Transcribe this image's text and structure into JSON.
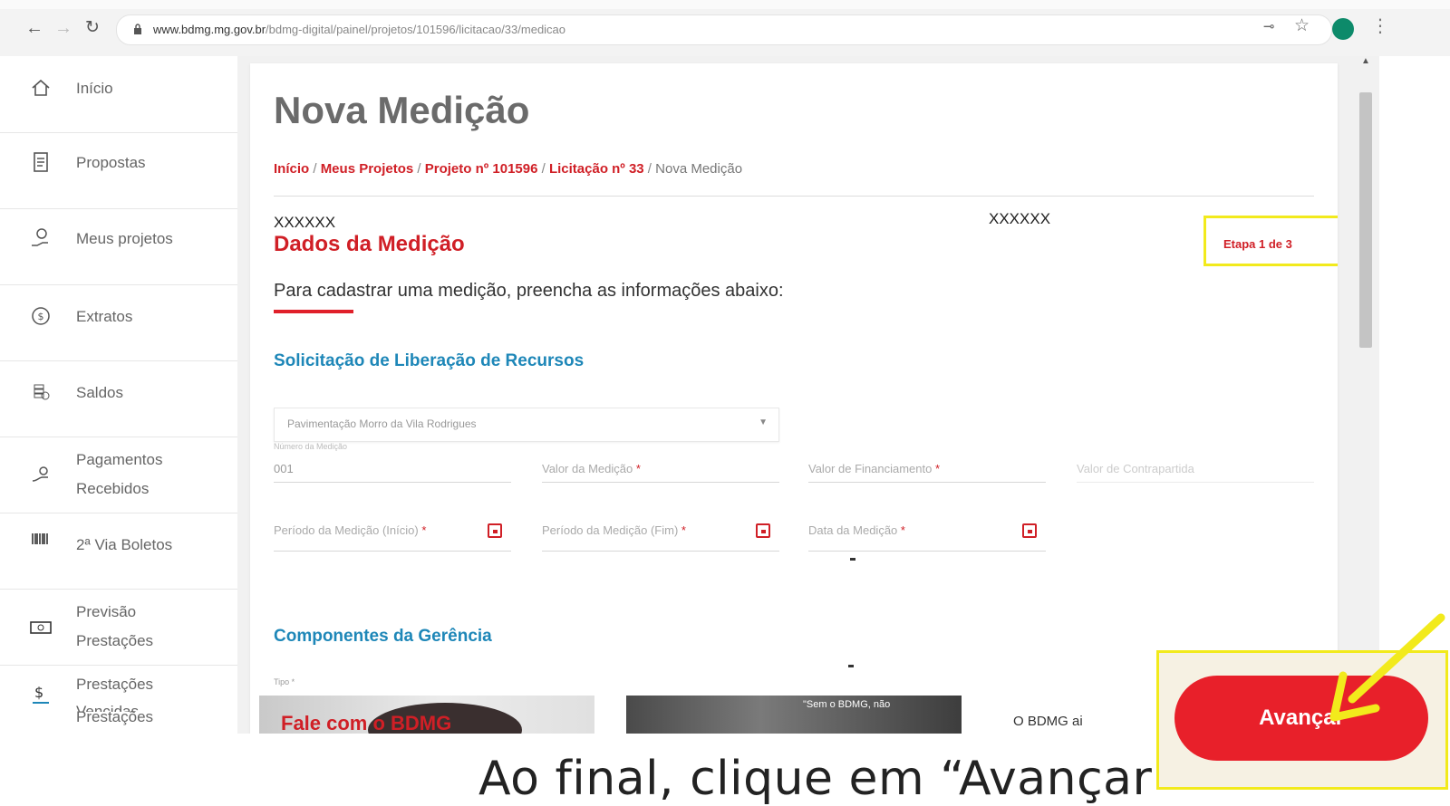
{
  "browser": {
    "url_domain": "www.bdmg.mg.gov.br",
    "url_path": "/bdmg-digital/painel/projetos/101596/licitacao/33/medicao"
  },
  "icons": {
    "back": "arrow-left-icon",
    "forward": "arrow-right-icon",
    "reload": "reload-icon",
    "lock": "lock-icon",
    "key": "key-icon",
    "star": "star-icon",
    "menu": "vertical-dots-icon"
  },
  "sidebar": {
    "items": [
      {
        "label": "Início",
        "icon": "home-icon"
      },
      {
        "label": "Propostas",
        "icon": "document-icon"
      },
      {
        "label": "Meus projetos",
        "icon": "hand-coin-icon"
      },
      {
        "label": "Extratos",
        "icon": "dollar-circle-icon"
      },
      {
        "label": "Saldos",
        "icon": "coins-icon"
      },
      {
        "label": "Pagamentos",
        "label2": "Recebidos",
        "icon": "payment-hand-icon"
      },
      {
        "label": "2ª Via Boletos",
        "icon": "barcode-icon"
      },
      {
        "label": "Previsão",
        "label2": "Prestações",
        "icon": "cash-icon"
      },
      {
        "label": "Prestações",
        "label2": "Vencidas",
        "icon": "dollar-strike-icon"
      },
      {
        "label": "Prestações",
        "icon": "dollar-strike-icon"
      }
    ]
  },
  "main": {
    "title": "Nova Medição",
    "breadcrumb": {
      "inicio": "Início",
      "meus_projetos": "Meus Projetos",
      "projeto": "Projeto nº 101596",
      "licitacao": "Licitação nº 33",
      "current": "Nova Medição",
      "sep": " / "
    },
    "xx_left": "XXXXXX",
    "xx_right": "XXXXXX",
    "section_title": "Dados da Medição",
    "step": "Etapa 1 de 3",
    "instructions": "Para cadastrar uma medição, preencha as informações abaixo:",
    "subsection1": "Solicitação de Liberação de Recursos",
    "select_value": "Pavimentação Morro da Vila Rodrigues",
    "fields": {
      "numero_label": "Número da Medição",
      "numero_value": "001",
      "valor_medicao": "Valor da Medição",
      "valor_financiamento": "Valor de Financiamento",
      "valor_contrapartida": "Valor de Contrapartida",
      "periodo_inicio": "Período da Medição (Início)",
      "periodo_fim": "Período da Medição (Fim)",
      "data_medicao": "Data da Medição",
      "required_mark": " *"
    },
    "subsection2": "Componentes da Gerência",
    "tipo_label": "Tipo *"
  },
  "banner": {
    "fale": "Fale com o BDMG",
    "quote": "\"Sem o BDMG, não",
    "bdmg_text": "O BDMG ai"
  },
  "cta": {
    "label": "Avançar"
  },
  "caption": "Ao final, clique em “Avançar”",
  "colors": {
    "brand_red": "#e8202a",
    "link_blue": "#1e87b8",
    "highlight_yellow": "#f2ea1c"
  }
}
